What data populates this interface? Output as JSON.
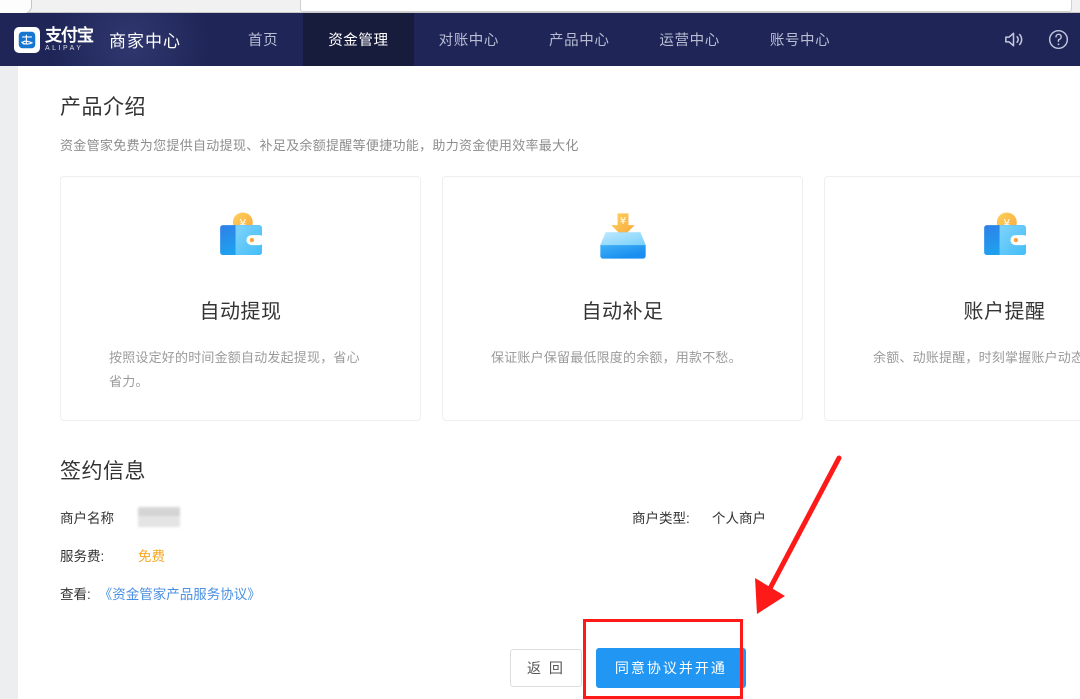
{
  "browser": {
    "chrome_visible": true
  },
  "topnav": {
    "brand_logo_icon": "alipay-logo-icon",
    "brand_name": "支付宝",
    "brand_name_sub": "ALIPAY",
    "brand_title": "商家中心",
    "items": [
      {
        "label": "首页",
        "active": false
      },
      {
        "label": "资金管理",
        "active": true
      },
      {
        "label": "对账中心",
        "active": false
      },
      {
        "label": "产品中心",
        "active": false
      },
      {
        "label": "运营中心",
        "active": false
      },
      {
        "label": "账号中心",
        "active": false
      }
    ],
    "right_icons": [
      {
        "name": "speaker-icon"
      },
      {
        "name": "help-circle-icon"
      }
    ],
    "background_color": "#1f2557",
    "active_tab_color": "#171b3c"
  },
  "product_intro": {
    "title": "产品介绍",
    "subtitle": "资金管家免费为您提供自动提现、补足及余额提醒等便捷功能，助力资金使用效率最大化",
    "cards": [
      {
        "icon": "wallet-yuan-icon",
        "title": "自动提现",
        "desc": "按照设定好的时间金额自动发起提现，省心省力。"
      },
      {
        "icon": "inbox-arrow-down-yuan-icon",
        "title": "自动补足",
        "desc": "保证账户保留最低限度的余额，用款不愁。"
      },
      {
        "icon": "wallet-yuan-icon",
        "title": "账户提醒",
        "desc": "余额、动账提醒，时刻掌握账户动态。"
      }
    ]
  },
  "sign_info": {
    "title": "签约信息",
    "merchant_name_label": "商户名称",
    "merchant_name_value": "",
    "merchant_type_label": "商户类型:",
    "merchant_type_value": "个人商户",
    "service_fee_label": "服务费:",
    "service_fee_value": "免费",
    "service_fee_color": "#f5a623",
    "view_label": "查看:",
    "agreement_link": "《资金管家产品服务协议》",
    "agreement_link_color": "#4a90e2"
  },
  "footer": {
    "back_label": "返 回",
    "primary_label": "同意协议并开通",
    "primary_color": "#2196f3"
  },
  "annotations": {
    "highlight_color": "#ff1a1a",
    "rect_target": "同意协议并开通",
    "arrow_label": "arrow-pointing-to-primary-button"
  }
}
